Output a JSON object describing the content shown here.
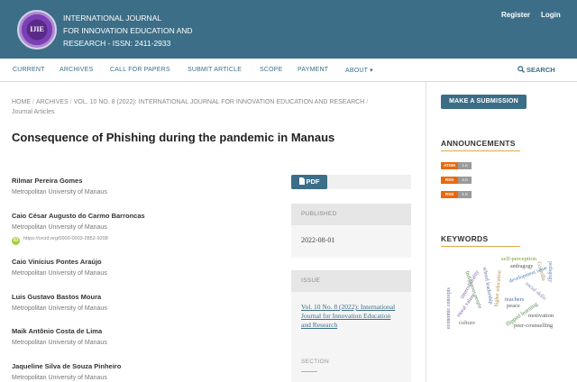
{
  "site": {
    "logo_text": "IJIE",
    "title_lines": [
      "INTERNATIONAL JOURNAL",
      "FOR INNOVATION EDUCATION AND",
      "RESEARCH - ISSN: 2411-2933"
    ]
  },
  "user_nav": {
    "register": "Register",
    "login": "Login"
  },
  "nav": {
    "items": [
      "CURRENT",
      "ARCHIVES",
      "CALL FOR PAPERS",
      "SUBMIT ARTICLE",
      "SCOPE",
      "PAYMENT",
      "ABOUT ▾"
    ],
    "search": "SEARCH"
  },
  "breadcrumbs": {
    "home": "HOME",
    "archives": "ARCHIVES",
    "issue": "VOL. 10 NO. 8 (2022): INTERNATIONAL JOURNAL FOR INNOVATION EDUCATION AND RESEARCH",
    "section": "Journal Articles"
  },
  "article": {
    "title": "Consequence of Phishing during the pandemic in Manaus",
    "authors": [
      {
        "name": "Rilmar Pereira Gomes",
        "affiliation": "Metropolitan University of Manaus"
      },
      {
        "name": "Caio César Augusto do Carmo Barroncas",
        "affiliation": "Metropolitan University of Manaus"
      },
      {
        "name": "Caio Vinícius Pontes Araújo",
        "affiliation": "Metropolitan University of Manaus"
      },
      {
        "name": "Luis Gustavo Bastos Moura",
        "affiliation": "Metropolitan University of Manaus"
      },
      {
        "name": "Maik Antônio Costa de Lima",
        "affiliation": "Metropolitan University of Manaus"
      },
      {
        "name": "Jaqueline Silva de Souza Pinheiro",
        "affiliation": "Metropolitan University of Manaus"
      }
    ],
    "orcid_badge": "iD",
    "orcid": "https://orcid.org/0000-0003-2852-9208"
  },
  "galley": {
    "pdf_label": "PDF"
  },
  "meta": {
    "published_label": "PUBLISHED",
    "published_date": "2022-08-01",
    "issue_label": "ISSUE",
    "issue_link": "Vol. 10 No. 8 (2022): International Journal for Innovation Education and Research",
    "section_label": "SECTION"
  },
  "sidebar": {
    "submit_label": "MAKE A SUBMISSION",
    "announcements_title": "ANNOUNCEMENTS",
    "feeds": [
      {
        "type": "ATOM",
        "version": "1.0"
      },
      {
        "type": "RSS",
        "version": "2.0"
      },
      {
        "type": "RSS",
        "version": "1.0"
      }
    ],
    "keywords_title": "KEYWORDS",
    "keywords": [
      "self-perception",
      "andragogy",
      "pedagogy",
      "interculturality",
      "development issue",
      "teachers",
      "peace",
      "flipped learning",
      "motivation",
      "peer-counselling",
      "culture",
      "economic concepts",
      "moral values",
      "Indigenous people",
      "higher education",
      "school leadership",
      "social skills",
      "Guerrilla"
    ]
  },
  "colors": {
    "brand": "#3c6e87",
    "accent": "#e0a84b",
    "feed_orange": "#e9690f"
  }
}
